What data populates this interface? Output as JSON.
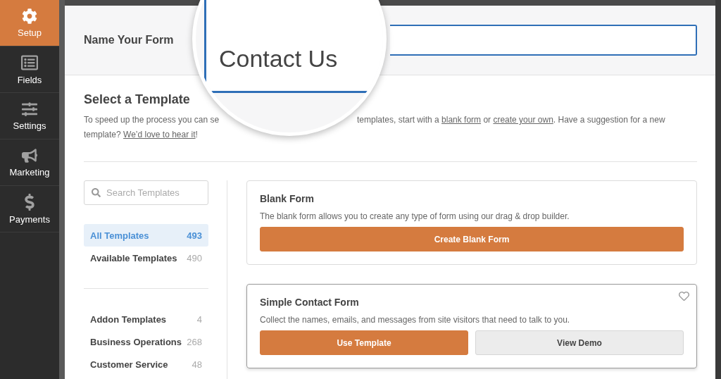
{
  "sidebar": {
    "items": [
      {
        "label": "Setup",
        "selected": true
      },
      {
        "label": "Fields",
        "selected": false
      },
      {
        "label": "Settings",
        "selected": false
      },
      {
        "label": "Marketing",
        "selected": false
      },
      {
        "label": "Payments",
        "selected": false
      }
    ]
  },
  "header": {
    "label": "Name Your Form",
    "form_name": {
      "value": "Contact Us"
    }
  },
  "select_template": {
    "title": "Select a Template",
    "description_start": "To speed up the process you can se",
    "description_line_1": [
      {
        "text": "templates, start with a ",
        "link": false
      },
      {
        "text": "blank form",
        "link": true
      },
      {
        "text": " or ",
        "link": false
      },
      {
        "text": "create your own",
        "link": true
      },
      {
        "text": ". Have a suggestion for a new",
        "link": false
      }
    ],
    "description_line_2": [
      {
        "text": "template? ",
        "link": false
      },
      {
        "text": "We’d love to hear it",
        "link": true
      },
      {
        "text": "!",
        "link": false
      }
    ]
  },
  "search": {
    "placeholder": "Search Templates"
  },
  "category_groups": [
    [
      {
        "label": "All Templates",
        "count": "493",
        "selected": true
      },
      {
        "label": "Available Templates",
        "count": "490",
        "selected": false
      }
    ],
    [
      {
        "label": "Addon Templates",
        "count": "4",
        "selected": false
      },
      {
        "label": "Business Operations",
        "count": "268",
        "selected": false
      },
      {
        "label": "Customer Service",
        "count": "48",
        "selected": false
      }
    ]
  ],
  "templates": [
    {
      "title": "Blank Form",
      "description": "The blank form allows you to create any type of form using our drag & drop builder.",
      "hovered": false,
      "buttons": [
        {
          "label": "Create Blank Form",
          "kind": "primary"
        }
      ]
    },
    {
      "title": "Simple Contact Form",
      "description": "Collect the names, emails, and messages from site visitors that need to talk to you.",
      "hovered": true,
      "buttons": [
        {
          "label": "Use Template",
          "kind": "primary"
        },
        {
          "label": "View Demo",
          "kind": "secondary"
        }
      ]
    }
  ]
}
